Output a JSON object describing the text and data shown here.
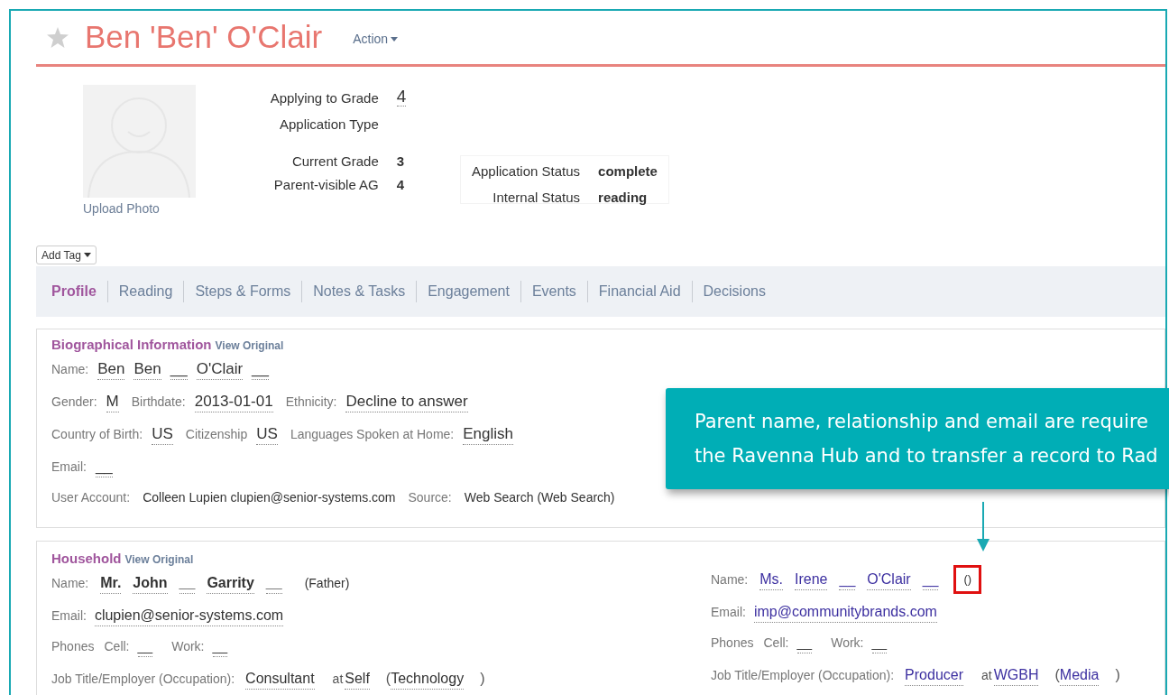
{
  "header": {
    "favorite": false,
    "title": "Ben 'Ben' O'Clair",
    "action": "Action"
  },
  "photo": {
    "upload": "Upload Photo"
  },
  "summary": [
    {
      "label": "Applying to Grade",
      "value": "4",
      "kind": "large"
    },
    {
      "label": "Application Type",
      "kind": "large"
    },
    {
      "label": "Current Grade",
      "value": "3",
      "kind": "small"
    },
    {
      "label": "Parent-visible AG",
      "value": "4",
      "kind": "small"
    }
  ],
  "status": [
    {
      "label": "Application Status",
      "value": "complete"
    },
    {
      "label": "Internal Status",
      "value": "reading"
    }
  ],
  "add_tag": "Add Tag",
  "tabs": [
    {
      "label": "Profile",
      "selected": true
    },
    {
      "label": "Reading",
      "selected": false
    },
    {
      "label": "Steps & Forms",
      "selected": false
    },
    {
      "label": "Notes & Tasks",
      "selected": false
    },
    {
      "label": "Engagement",
      "selected": false
    },
    {
      "label": "Events",
      "selected": false
    },
    {
      "label": "Financial Aid",
      "selected": false
    },
    {
      "label": "Decisions",
      "selected": false
    }
  ],
  "bio": {
    "title": "Biographical Information",
    "link": "View Original",
    "rows": [
      [
        {
          "label": "Name:",
          "kind": "editable",
          "values": [
            "Ben",
            "Ben",
            "__",
            "O'Clair",
            "__"
          ]
        }
      ],
      [
        {
          "label": "Gender:",
          "kind": "editable",
          "values": [
            "M"
          ]
        },
        {
          "label": "Birthdate:",
          "kind": "editable",
          "values": [
            "2013-01-01"
          ]
        },
        {
          "label": "Ethnicity:",
          "kind": "editable",
          "values": [
            "Decline to answer"
          ]
        }
      ],
      [
        {
          "label": "Country of Birth:",
          "kind": "editable",
          "values": [
            "US"
          ]
        },
        {
          "label": "Citizenship",
          "kind": "editable",
          "values": [
            "US"
          ]
        },
        {
          "label": "Languages Spoken at Home:",
          "kind": "editable",
          "values": [
            "English"
          ]
        }
      ],
      [
        {
          "label": "Email:",
          "kind": "editable",
          "values": [
            "__"
          ]
        }
      ],
      [
        {
          "label": "User Account:",
          "kind": "plain",
          "values": [
            "Colleen Lupien clupien@senior-systems.com"
          ]
        },
        {
          "label": "Source:",
          "kind": "plain",
          "values": [
            "Web Search (Web Search)"
          ]
        }
      ]
    ]
  },
  "household": {
    "title": "Household",
    "link": "View Original",
    "parents": [
      {
        "linked": false,
        "name_label": "Name:",
        "name": [
          "Mr.",
          "John",
          "__",
          "Garrity",
          "__"
        ],
        "relationship": "(Father)",
        "highlighted": false,
        "email_label": "Email:",
        "email": "clupien@senior-systems.com",
        "phones_label": "Phones",
        "phones": [
          {
            "label": "Cell:",
            "value": "__"
          },
          {
            "label": "Work:",
            "value": "__"
          }
        ],
        "job": {
          "label": "Job Title/Employer (Occupation):",
          "title": "Consultant",
          "at": "at",
          "employer": "Self",
          "open": "(",
          "occupation": "Technology",
          "close": ")"
        }
      },
      {
        "linked": true,
        "name_label": "Name:",
        "name": [
          "Ms.",
          "Irene",
          "__",
          "O'Clair",
          "__"
        ],
        "relationship": "()",
        "highlighted": true,
        "email_label": "Email:",
        "email": "imp@communitybrands.com",
        "phones_label": "Phones",
        "phones": [
          {
            "label": "Cell:",
            "value": "__"
          },
          {
            "label": "Work:",
            "value": "__"
          }
        ],
        "job": {
          "label": "Job Title/Employer (Occupation):",
          "title": "Producer",
          "at": "at",
          "employer": "WGBH",
          "open": "(",
          "occupation": "Media",
          "close": ")"
        }
      }
    ]
  },
  "callout": {
    "lines": [
      "Parent name, relationship and email are require",
      "the Ravenna Hub and to transfer a record to Rad"
    ]
  }
}
